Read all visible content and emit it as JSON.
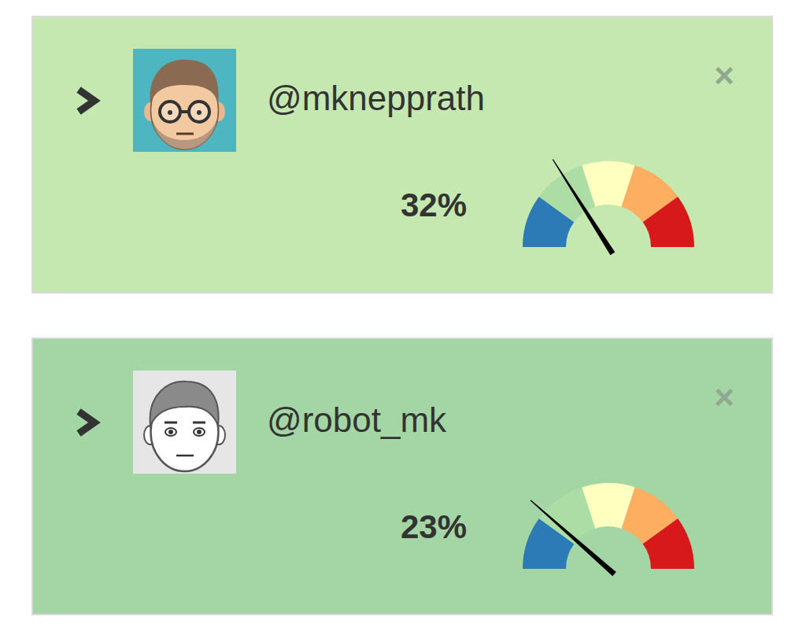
{
  "cards": [
    {
      "handle": "@mknepprath",
      "score": "32%",
      "level": 0.32,
      "close": "×",
      "kind": "human",
      "color": "#c5e8b0"
    },
    {
      "handle": "@robot_mk",
      "score": "23%",
      "level": 0.23,
      "close": "×",
      "kind": "robot",
      "color": "#a3d6a4"
    }
  ]
}
